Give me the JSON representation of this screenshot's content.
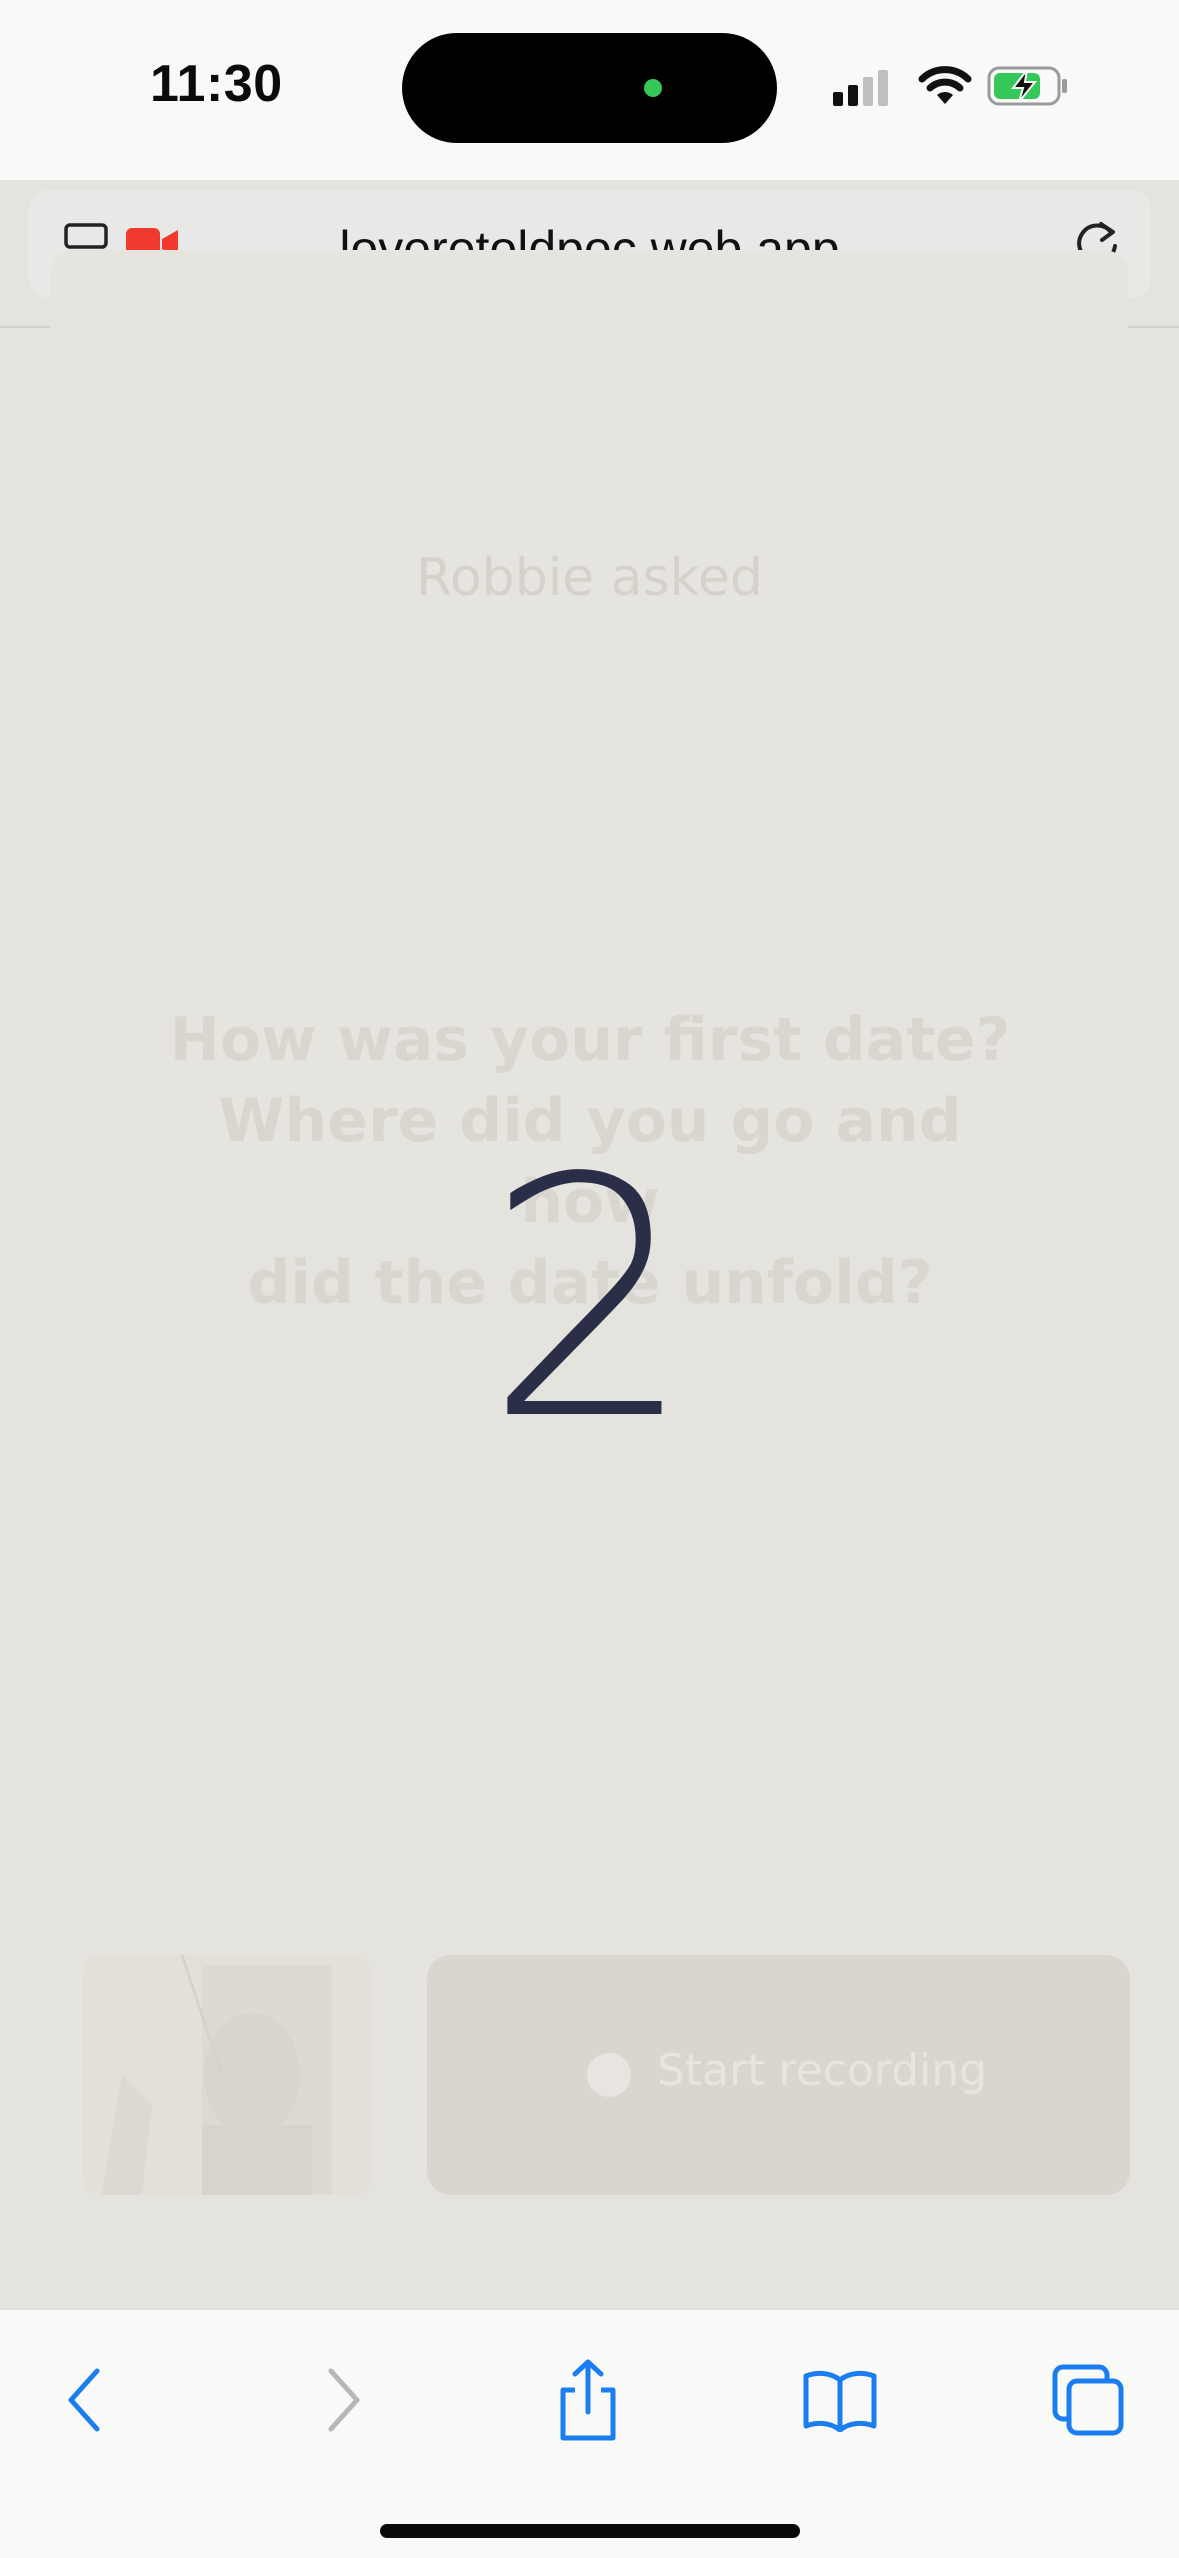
{
  "status_bar": {
    "time": "11:30",
    "icons": [
      "cellular-signal-icon",
      "wifi-icon",
      "battery-charging-icon"
    ]
  },
  "browser": {
    "url": "loveretoldpoc.web.app",
    "left_icons": [
      "reader-mode-icon",
      "camera-in-use-icon"
    ],
    "reload_icon": "reload-icon"
  },
  "question_card": {
    "asker": "Robbie asked",
    "question_lines": [
      "How was your first date?",
      "Where did you go and how",
      "did the date unfold?"
    ]
  },
  "countdown": {
    "value": "2"
  },
  "recording": {
    "button_label": "Start recording"
  },
  "toolbar": {
    "items": [
      "back-icon",
      "forward-icon",
      "share-icon",
      "bookmarks-icon",
      "tabs-icon"
    ]
  },
  "colors": {
    "background": "#e5e3de",
    "countdown": "#2a2e47",
    "safari_blue": "#1a7ef1",
    "recording_red": "#f2392e"
  }
}
